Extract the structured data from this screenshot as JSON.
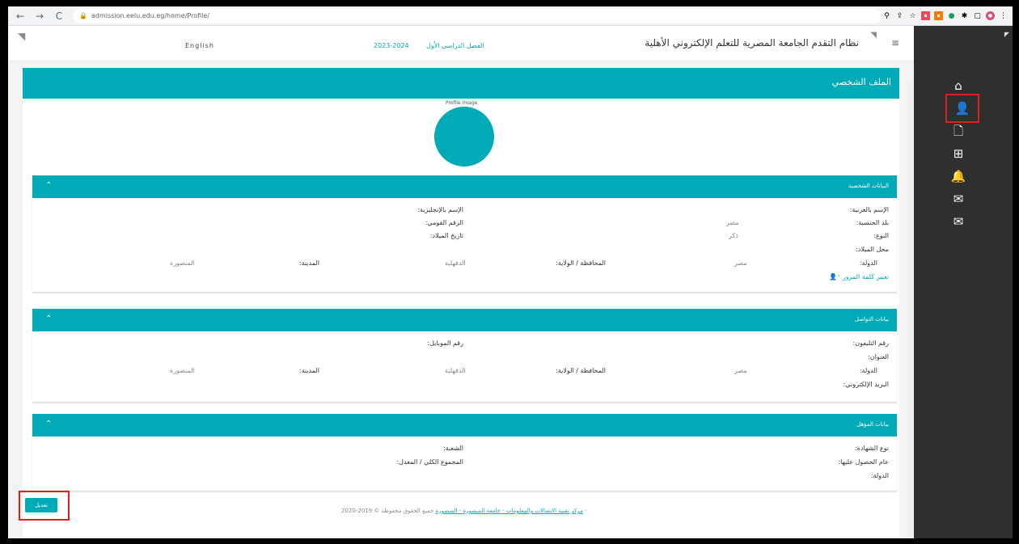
{
  "browser": {
    "url": "admission.eelu.edu.eg/home/Profile/",
    "back": "←",
    "forward": "→",
    "reload": "C"
  },
  "topbar": {
    "language": "English",
    "year": "2023-2024",
    "term": "الفصل الدراسي الأول",
    "system_title": "نظام التقدم الجامعة المصرية للتعلم الإلكتروني الأهلية"
  },
  "profile": {
    "title": "الملف الشخصي",
    "image_alt": "Profile Image"
  },
  "personal": {
    "title": "البيانات الشخصية",
    "name_ar_label": "الإسم بالعربية:",
    "name_en_label": "الإسم بالإنجليزية:",
    "nationality_label": "بلد الجنسية:",
    "nationality_value": "مصر",
    "national_id_label": "الرقم القومي:",
    "gender_label": "النوع:",
    "gender_value": "ذكر",
    "birthdate_label": "تاريخ الميلاد:",
    "birthplace_label": "محل الميلاد:",
    "country_label": "الدولة:",
    "country_value": "مصر",
    "governorate_label": "المحافظة / الولاية:",
    "governorate_value": "الدقهلية",
    "city_label": "المدينة:",
    "city_value": "المنصورة",
    "change_password": "تغيير كلمة المرور"
  },
  "contact": {
    "title": "بيانات التواصل",
    "phone_label": "رقم التليفون:",
    "mobile_label": "رقم الموبايل:",
    "address_label": "العنوان:",
    "country_label": "الدولة:",
    "country_value": "مصر",
    "governorate_label": "المحافظة / الولاية:",
    "governorate_value": "الدقهلية",
    "city_label": "المدينة:",
    "city_value": "المنصورة",
    "email_label": "البريد الإلكتروني:"
  },
  "qualification": {
    "title": "بيانات المؤهل",
    "cert_type_label": "نوع الشهادة:",
    "branch_label": "الشعبة:",
    "year_label": "عام الحصول عليها:",
    "total_label": "المجموع الكلي / المعدل:",
    "country_label": "الدولة:"
  },
  "actions": {
    "edit": "تعديل"
  },
  "footer": {
    "text": "جميع الحقوق محفوظة © 2019-2020 -",
    "link": "مركز تقنية الاتصالات والمعلومات - جامعة المنصورة - المنصورة"
  },
  "colors": {
    "accent": "#00aab7",
    "sidebar": "#2f2f2f",
    "highlight": "#e02020"
  },
  "sidebar_icons": [
    "home-icon",
    "user-icon",
    "document-icon",
    "file-plus-icon",
    "bell-icon",
    "mail-icon",
    "inbox-icon"
  ]
}
